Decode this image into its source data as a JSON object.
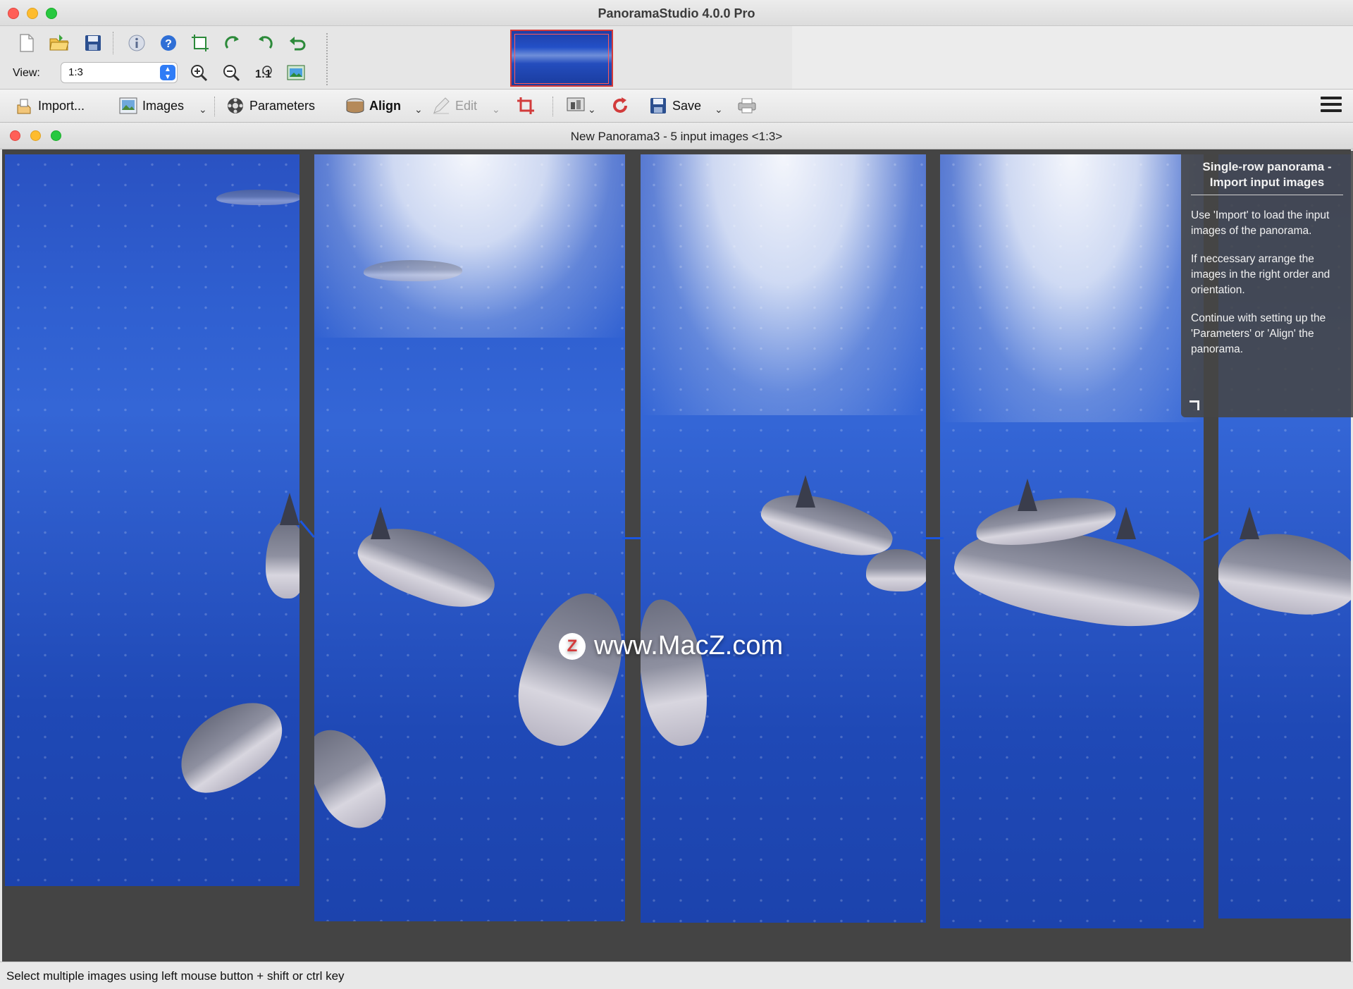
{
  "app": {
    "title": "PanoramaStudio 4.0.0 Pro"
  },
  "toolbar_icons": {
    "row1": [
      "new-document-icon",
      "open-folder-icon",
      "save-disk-icon",
      "info-icon",
      "help-icon",
      "crop-frame-icon",
      "rotate-left-icon",
      "rotate-right-icon",
      "undo-icon"
    ],
    "row2": [
      "zoom-in-icon",
      "zoom-out-icon",
      "zoom-actual-icon",
      "fit-to-window-icon"
    ]
  },
  "view": {
    "label": "View:",
    "value": "1:3"
  },
  "commands": {
    "import": "Import...",
    "images": "Images",
    "parameters": "Parameters",
    "align": "Align",
    "edit": "Edit",
    "save": "Save"
  },
  "document": {
    "title": "New Panorama3 - 5 input images <1:3>"
  },
  "watermark": {
    "logo": "Z",
    "text": "www.MacZ.com"
  },
  "help_panel": {
    "title": "Single-row panorama - Import input images",
    "paragraphs": [
      "Use 'Import' to load the input images of the panorama.",
      "If neccessary arrange the images in the right order and orientation.",
      "Continue with setting up the 'Parameters' or 'Align' the panorama."
    ]
  },
  "status": {
    "text": "Select multiple images using left mouse button + shift or ctrl key"
  },
  "colors": {
    "canvas_bg": "#444444",
    "accent": "#2f7cf6",
    "thumb_border": "#d43a3a"
  }
}
